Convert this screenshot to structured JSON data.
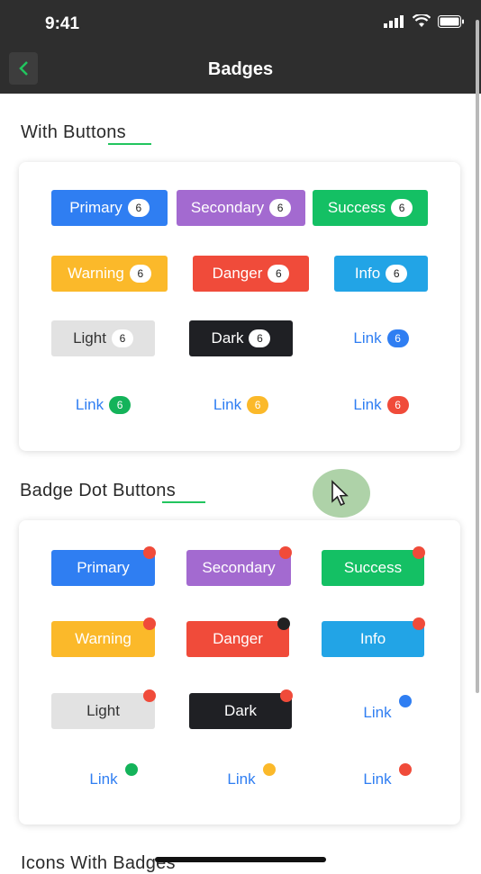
{
  "status_bar": {
    "time": "9:41"
  },
  "nav": {
    "title": "Badges"
  },
  "sections": {
    "with_buttons": "With Buttons",
    "badge_dot_buttons": "Badge Dot Buttons",
    "icons_with_badges": "Icons With Badges"
  },
  "badge_buttons": [
    {
      "label": "Primary",
      "count": "6"
    },
    {
      "label": "Secondary",
      "count": "6"
    },
    {
      "label": "Success",
      "count": "6"
    },
    {
      "label": "Warning",
      "count": "6"
    },
    {
      "label": "Danger",
      "count": "6"
    },
    {
      "label": "Info",
      "count": "6"
    },
    {
      "label": "Light",
      "count": "6"
    },
    {
      "label": "Dark",
      "count": "6"
    },
    {
      "label": "Link",
      "count": "6"
    },
    {
      "label": "Link",
      "count": "6"
    },
    {
      "label": "Link",
      "count": "6"
    },
    {
      "label": "Link",
      "count": "6"
    }
  ],
  "dot_buttons": [
    {
      "label": "Primary"
    },
    {
      "label": "Secondary"
    },
    {
      "label": "Success"
    },
    {
      "label": "Warning"
    },
    {
      "label": "Danger"
    },
    {
      "label": "Info"
    },
    {
      "label": "Light"
    },
    {
      "label": "Dark"
    },
    {
      "label": "Link"
    },
    {
      "label": "Link"
    },
    {
      "label": "Link"
    },
    {
      "label": "Link"
    }
  ],
  "colors": {
    "primary": "#2f7ef2",
    "secondary": "#a36ad0",
    "success": "#14c064",
    "warning": "#fbb92a",
    "danger": "#f04b3a",
    "info": "#22a4e6",
    "light": "#e2e2e2",
    "dark": "#1f2024",
    "accent_underline": "#22c55e"
  },
  "icons": [
    "signal-icon",
    "wifi-icon",
    "battery-icon",
    "back-chevron-icon",
    "cursor-icon"
  ]
}
